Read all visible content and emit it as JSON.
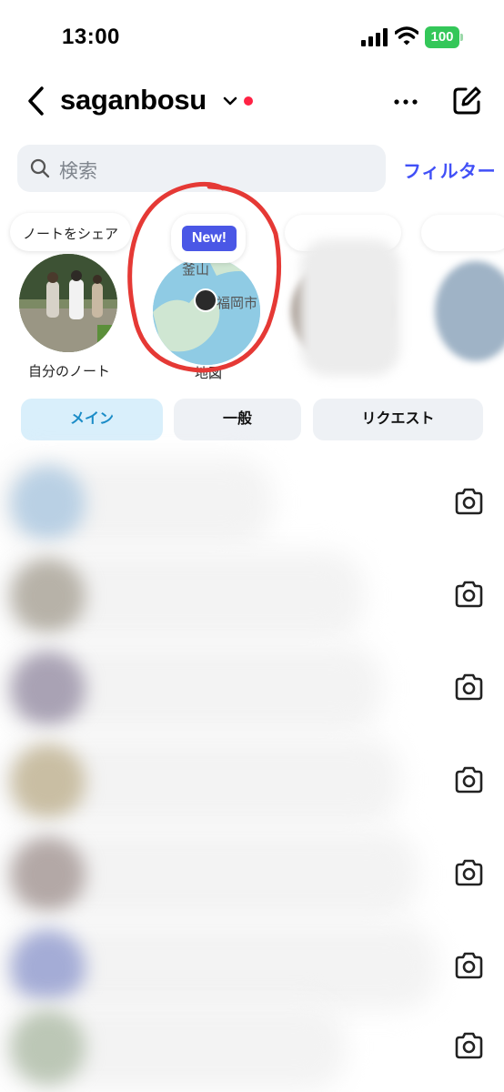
{
  "status_bar": {
    "time": "13:00",
    "battery": "100"
  },
  "header": {
    "username": "saganbosu",
    "more_label": "more-options",
    "compose_label": "new-message"
  },
  "search": {
    "placeholder": "検索",
    "filter_label": "フィルター"
  },
  "notes": {
    "own": {
      "bubble": "ノートをシェア",
      "caption": "自分のノート"
    },
    "map": {
      "badge": "New!",
      "label_busan": "釜山",
      "label_fukuoka": "福岡市",
      "caption": "地図"
    }
  },
  "tabs": [
    {
      "label": "メイン",
      "active": true
    },
    {
      "label": "一般",
      "active": false
    },
    {
      "label": "リクエスト",
      "active": false
    }
  ],
  "threads_count": 7,
  "colors": {
    "accent": "#4150f7",
    "active_tab_bg": "#d9effb",
    "active_tab_text": "#1b8cc7",
    "badge": "#4a57e6",
    "battery": "#34c759",
    "highlight_circle": "#e53935"
  }
}
